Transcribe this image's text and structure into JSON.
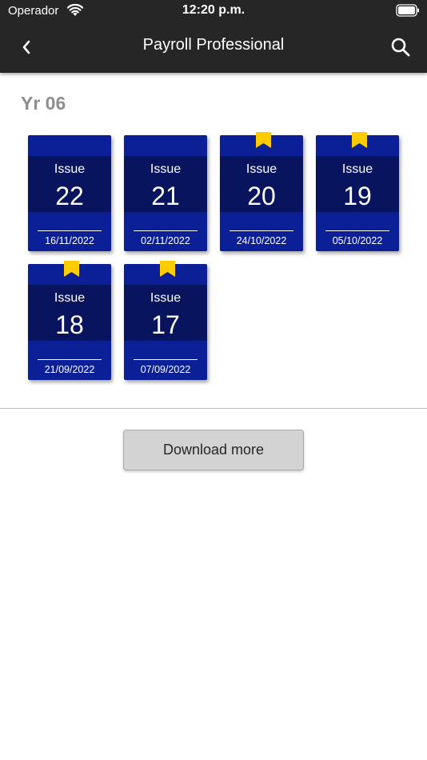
{
  "status_bar": {
    "carrier": "Operador",
    "time": "12:20 p.m.",
    "wifi_icon": "wifi-icon",
    "battery_icon": "battery-icon"
  },
  "nav": {
    "title": "Payroll Professional",
    "back_icon": "chevron-left-icon",
    "search_icon": "search-icon"
  },
  "section": {
    "title": "Yr 06"
  },
  "issues": [
    {
      "label": "Issue",
      "number": "22",
      "date": "16/11/2022",
      "bookmarked": false
    },
    {
      "label": "Issue",
      "number": "21",
      "date": "02/11/2022",
      "bookmarked": false
    },
    {
      "label": "Issue",
      "number": "20",
      "date": "24/10/2022",
      "bookmarked": true
    },
    {
      "label": "Issue",
      "number": "19",
      "date": "05/10/2022",
      "bookmarked": true
    },
    {
      "label": "Issue",
      "number": "18",
      "date": "21/09/2022",
      "bookmarked": true
    },
    {
      "label": "Issue",
      "number": "17",
      "date": "07/09/2022",
      "bookmarked": true
    }
  ],
  "download_button": {
    "label": "Download more"
  },
  "colors": {
    "nav_background": "#262626",
    "card_blue": "#0b1f96",
    "card_band": "#08155e",
    "bookmark_yellow": "#ffcc00",
    "section_title_gray": "#8e8e8e"
  }
}
